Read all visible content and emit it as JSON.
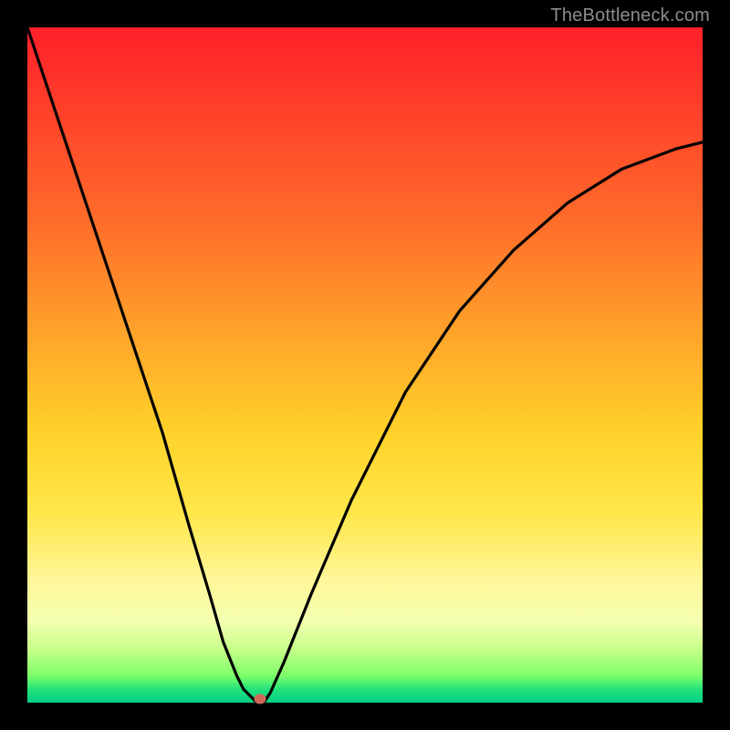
{
  "attribution": "TheBottleneck.com",
  "colors": {
    "background": "#000000",
    "gradient_top": "#ff1f2a",
    "gradient_bottom": "#04cf86",
    "curve": "#000000",
    "marker": "#cf6a5a"
  },
  "chart_data": {
    "type": "line",
    "title": "",
    "xlabel": "",
    "ylabel": "",
    "xlim": [
      0,
      100
    ],
    "ylim": [
      0,
      100
    ],
    "series": [
      {
        "name": "bottleneck-curve",
        "x": [
          0,
          5,
          10,
          15,
          20,
          24,
          27,
          29,
          31,
          32,
          33,
          34,
          35,
          36,
          38,
          42,
          48,
          56,
          64,
          72,
          80,
          88,
          96,
          100
        ],
        "values": [
          100,
          85,
          70,
          55,
          40,
          26,
          16,
          9,
          4,
          2,
          1,
          0,
          0,
          1.5,
          6,
          16,
          30,
          46,
          58,
          67,
          74,
          79,
          82,
          83
        ]
      }
    ],
    "annotations": [
      {
        "name": "min-marker",
        "x": 34.5,
        "y": 0.5
      }
    ]
  }
}
